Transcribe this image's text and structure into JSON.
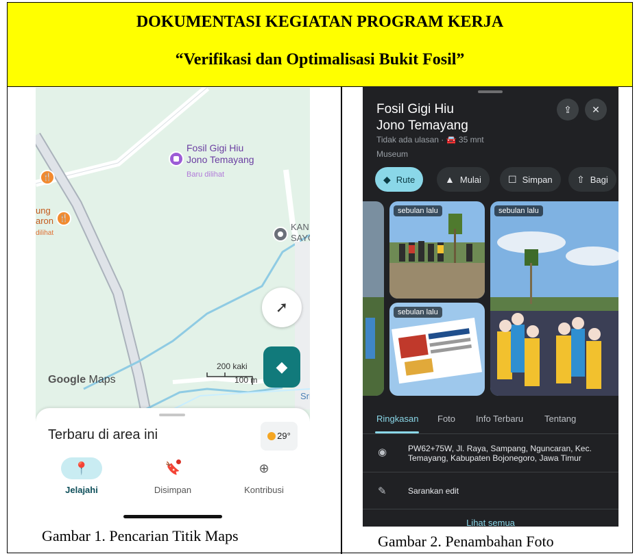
{
  "document": {
    "title": "DOKUMENTASI KEGIATAN PROGRAM KERJA",
    "subtitle": "“Verifikasi dan Optimalisasi Bukit Fosil”",
    "caption_1": "Gambar 1. Pencarian Titik Maps",
    "caption_2": "Gambar 2. Penambahan Foto"
  },
  "maps_screen": {
    "poi": {
      "name_line1": "Fosil Gigi Hiu",
      "name_line2": "Jono Temayang",
      "status": "Baru dilihat"
    },
    "food_poi": {
      "label_line1": "ung",
      "label_line2": "aron",
      "sub": "dilihat"
    },
    "nearby_label_line1": "KAN",
    "nearby_label_line2": "SAYO",
    "edge_label": "Sri",
    "logo_bold": "Google",
    "logo_text": " Maps",
    "scale_ft": "200 kaki",
    "scale_m": "100 m",
    "sheet_title": "Terbaru di area ini",
    "weather": "29°",
    "tabs": [
      {
        "label": "Jelajahi",
        "icon": "location-pin-icon",
        "active": true
      },
      {
        "label": "Disimpan",
        "icon": "bookmark-icon",
        "active": false
      },
      {
        "label": "Kontribusi",
        "icon": "add-circle-icon",
        "active": false
      }
    ]
  },
  "place_screen": {
    "title_line1": "Fosil Gigi Hiu",
    "title_line2": "Jono Temayang",
    "meta": "Tidak ada ulasan · 🚘 35 mnt",
    "category": "Museum",
    "chips": [
      {
        "label": "Rute",
        "icon": "directions-icon"
      },
      {
        "label": "Mulai",
        "icon": "navigation-arrow-icon"
      },
      {
        "label": "Simpan",
        "icon": "bookmark-icon"
      },
      {
        "label": "Bagi",
        "icon": "share-icon"
      }
    ],
    "photo_tag": "sebulan lalu",
    "tabs": [
      "Ringkasan",
      "Foto",
      "Info Terbaru",
      "Tentang"
    ],
    "address_line1": "PW62+75W, Jl. Raya, Sampang, Nguncaran, Kec.",
    "address_line2": "Temayang, Kabupaten Bojonegoro, Jawa Timur",
    "suggest_edit": "Sarankan edit",
    "see_all": "Lihat semua",
    "colors": {
      "accent": "#8ad7e8",
      "background": "#202124"
    }
  }
}
